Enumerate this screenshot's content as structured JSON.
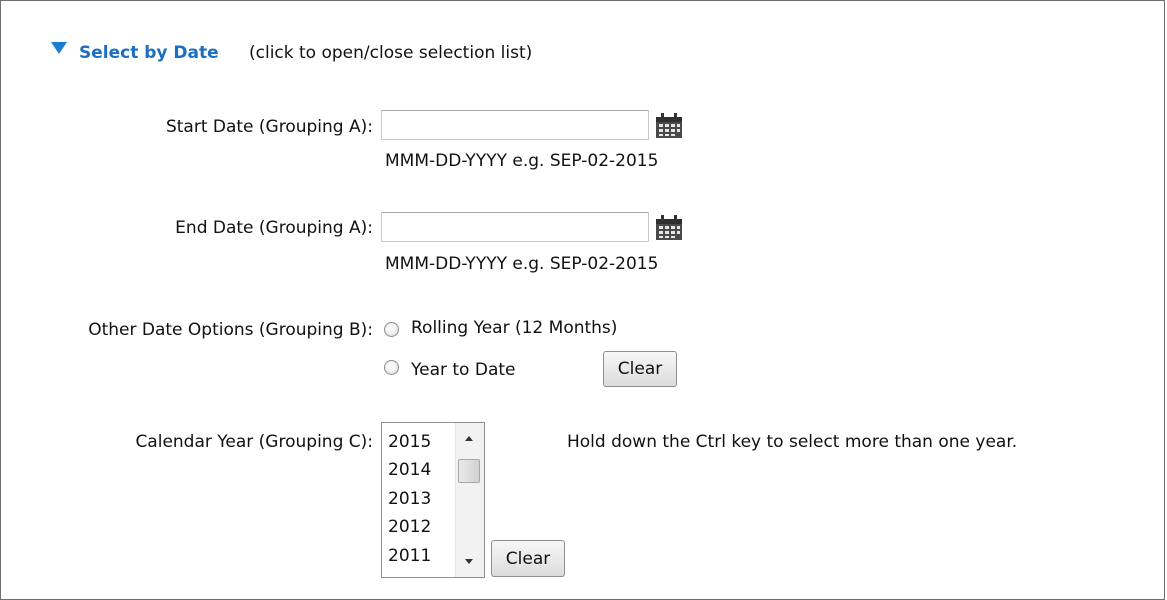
{
  "section": {
    "title": "Select by Date",
    "hint": "(click to open/close selection list)"
  },
  "start_date": {
    "label": "Start Date (Grouping A):",
    "value": "",
    "format_hint": "MMM-DD-YYYY e.g. SEP-02-2015",
    "icon": "calendar-icon"
  },
  "end_date": {
    "label": "End Date (Grouping A):",
    "value": "",
    "format_hint": "MMM-DD-YYYY e.g. SEP-02-2015",
    "icon": "calendar-icon"
  },
  "other_options": {
    "label": "Other Date Options (Grouping B):",
    "options": [
      {
        "label": "Rolling Year (12 Months)",
        "selected": false
      },
      {
        "label": "Year to Date",
        "selected": false
      }
    ],
    "clear_label": "Clear"
  },
  "calendar_year": {
    "label": "Calendar Year (Grouping C):",
    "years": [
      "2015",
      "2014",
      "2013",
      "2012",
      "2011"
    ],
    "hint": "Hold down the Ctrl key to select more than one year.",
    "clear_label": "Clear"
  },
  "colors": {
    "link": "#1a6fc4",
    "arrow": "#1a7fd4"
  }
}
